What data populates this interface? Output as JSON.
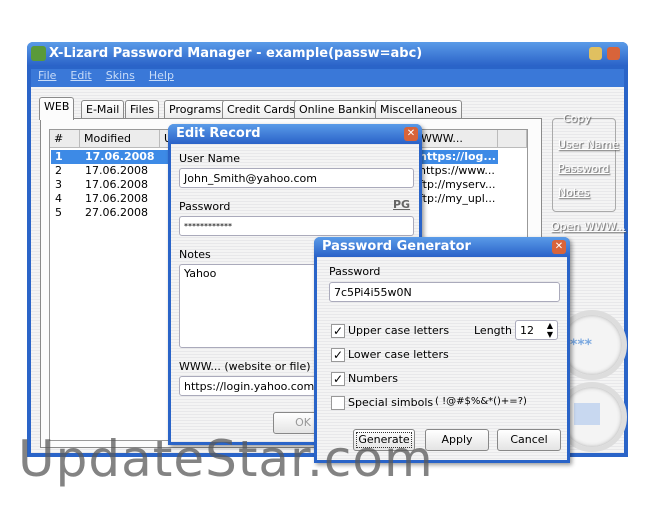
{
  "window": {
    "title": "X-Lizard Password Manager - example(passw=abc)"
  },
  "menu": [
    "File",
    "Edit",
    "Skins",
    "Help"
  ],
  "tabs": [
    "WEB",
    "E-Mail",
    "Files",
    "Programs",
    "Credit Cards",
    "Online Banking",
    "Miscellaneous"
  ],
  "table": {
    "headers": [
      "#",
      "Modified",
      "U",
      "WWW..."
    ],
    "rows": [
      [
        "1",
        "17.06.2008",
        "https://log..."
      ],
      [
        "2",
        "17.06.2008",
        "https://www..."
      ],
      [
        "3",
        "17.06.2008",
        "ftp://myserv..."
      ],
      [
        "4",
        "17.06.2008",
        "ftp://my_upl..."
      ],
      [
        "5",
        "27.06.2008",
        ""
      ]
    ]
  },
  "copy_panel": {
    "title": "Copy",
    "user_name": "User Name",
    "password": "Password",
    "notes": "Notes",
    "open_www": "Open WWW..."
  },
  "masked_glyph": "***",
  "edit_record": {
    "title": "Edit Record",
    "user_name_label": "User Name",
    "user_name": "John_Smith@yahoo.com",
    "password_label": "Password",
    "pg": "PG",
    "password": "************",
    "notes_label": "Notes",
    "notes": "Yahoo",
    "www_label": "WWW... (website or file)",
    "www": "https://login.yahoo.com",
    "ok": "OK"
  },
  "generator": {
    "title": "Password Generator",
    "password_label": "Password",
    "password": "7c5Pi4i55w0N",
    "upper": "Upper case letters",
    "lower": "Lower case letters",
    "numbers": "Numbers",
    "special": "Special simbols",
    "special_chars": "( !@#$%&*()+=?)",
    "length_label": "Length",
    "length": "12",
    "generate": "Generate",
    "apply": "Apply",
    "cancel": "Cancel"
  },
  "watermark": "UpdateStar.com"
}
